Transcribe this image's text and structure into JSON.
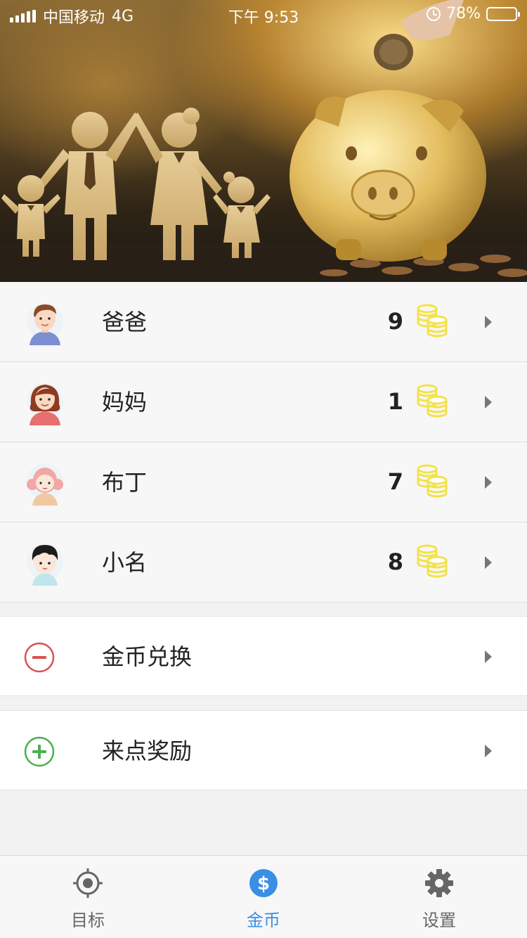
{
  "status_bar": {
    "carrier": "中国移动",
    "network": "4G",
    "time": "下午 9:53",
    "battery": "78%",
    "battery_level": 0.78
  },
  "hero": {
    "description_icon": "family-piggy-bank-banner"
  },
  "members": [
    {
      "name": "爸爸",
      "coins": "9",
      "avatar_icon": "dad-avatar-icon"
    },
    {
      "name": "妈妈",
      "coins": "1",
      "avatar_icon": "mom-avatar-icon"
    },
    {
      "name": "布丁",
      "coins": "7",
      "avatar_icon": "girl-avatar-icon"
    },
    {
      "name": "小名",
      "coins": "8",
      "avatar_icon": "boy-avatar-icon"
    }
  ],
  "actions": {
    "exchange": {
      "label": "金币兑换",
      "icon": "minus-circle-icon",
      "color": "#d9534f"
    },
    "reward": {
      "label": "来点奖励",
      "icon": "plus-circle-icon",
      "color": "#4caf50"
    }
  },
  "tabs": [
    {
      "label": "目标",
      "icon": "target-icon",
      "active": false
    },
    {
      "label": "金币",
      "icon": "dollar-coin-icon",
      "active": true
    },
    {
      "label": "设置",
      "icon": "gear-icon",
      "active": false
    }
  ],
  "colors": {
    "accent": "#3a8ee6",
    "coin": "#f3e24a",
    "exchange": "#d9534f",
    "reward": "#4caf50"
  }
}
